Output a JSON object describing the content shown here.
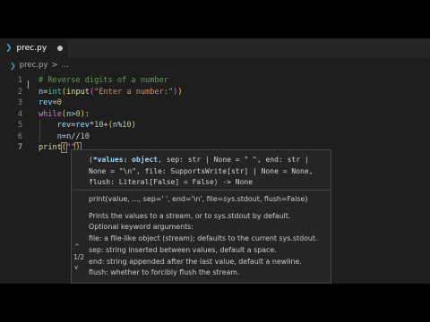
{
  "tab": {
    "icon": "python-file-icon",
    "label": "prec.py"
  },
  "breadcrumbs": {
    "file": "prec.py",
    "separator": ">",
    "more": "..."
  },
  "editor": {
    "line_numbers": [
      "1",
      "2",
      "3",
      "4",
      "5",
      "6",
      "7"
    ]
  },
  "hover": {
    "docs": [
      "print(value, ..., sep=' ', end='\\n', file=sys.stdout, flush=False)",
      "Prints the values to a stream, or to sys.stdout by default.",
      "Optional keyword arguments:",
      "file: a file-like object (stream); defaults to the current sys.stdout.",
      "sep: string inserted between values, default a space.",
      "end: string appended after the last value, default a newline.",
      "flush: whether to forcibly flush the stream."
    ],
    "nav": {
      "up": "^",
      "count": "1/2",
      "down": "v"
    }
  },
  "colors": {
    "editor_bg": "#1e1e1e",
    "comment": "#6a9955",
    "keyword": "#c586c0",
    "variable": "#9cdcfe",
    "function": "#dcdcaa",
    "string": "#ce9178",
    "number": "#b5cea8"
  }
}
